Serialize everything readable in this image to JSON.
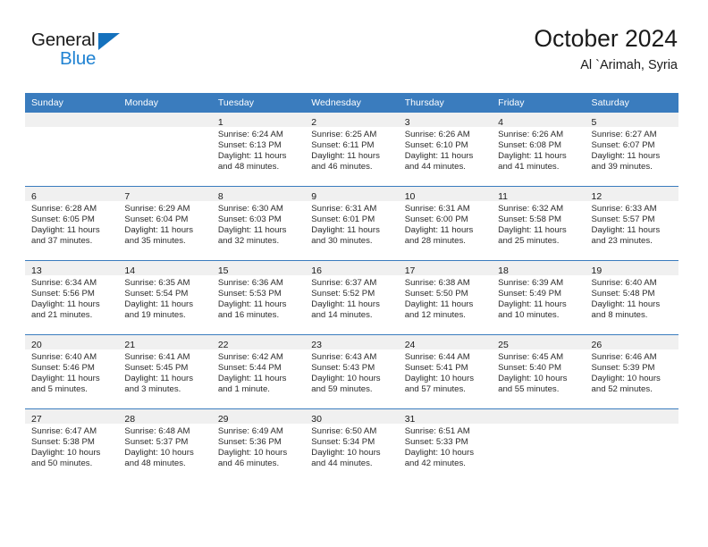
{
  "brand": {
    "name_top": "General",
    "name_bottom": "Blue",
    "triangle_color": "#1471bd",
    "blue_color": "#1f82d2"
  },
  "header": {
    "title": "October 2024",
    "subtitle": "Al `Arimah, Syria"
  },
  "theme": {
    "header_row_bg": "#3a7cbe",
    "daynum_band_bg": "#f0f0f0",
    "row_rule": "#3a7cbe",
    "text": "#1a1a1a"
  },
  "weekday_headers": [
    "Sunday",
    "Monday",
    "Tuesday",
    "Wednesday",
    "Thursday",
    "Friday",
    "Saturday"
  ],
  "weeks": [
    [
      {
        "day": "",
        "lines": []
      },
      {
        "day": "",
        "lines": []
      },
      {
        "day": "1",
        "lines": [
          "Sunrise: 6:24 AM",
          "Sunset: 6:13 PM",
          "Daylight: 11 hours",
          "and 48 minutes."
        ]
      },
      {
        "day": "2",
        "lines": [
          "Sunrise: 6:25 AM",
          "Sunset: 6:11 PM",
          "Daylight: 11 hours",
          "and 46 minutes."
        ]
      },
      {
        "day": "3",
        "lines": [
          "Sunrise: 6:26 AM",
          "Sunset: 6:10 PM",
          "Daylight: 11 hours",
          "and 44 minutes."
        ]
      },
      {
        "day": "4",
        "lines": [
          "Sunrise: 6:26 AM",
          "Sunset: 6:08 PM",
          "Daylight: 11 hours",
          "and 41 minutes."
        ]
      },
      {
        "day": "5",
        "lines": [
          "Sunrise: 6:27 AM",
          "Sunset: 6:07 PM",
          "Daylight: 11 hours",
          "and 39 minutes."
        ]
      }
    ],
    [
      {
        "day": "6",
        "lines": [
          "Sunrise: 6:28 AM",
          "Sunset: 6:05 PM",
          "Daylight: 11 hours",
          "and 37 minutes."
        ]
      },
      {
        "day": "7",
        "lines": [
          "Sunrise: 6:29 AM",
          "Sunset: 6:04 PM",
          "Daylight: 11 hours",
          "and 35 minutes."
        ]
      },
      {
        "day": "8",
        "lines": [
          "Sunrise: 6:30 AM",
          "Sunset: 6:03 PM",
          "Daylight: 11 hours",
          "and 32 minutes."
        ]
      },
      {
        "day": "9",
        "lines": [
          "Sunrise: 6:31 AM",
          "Sunset: 6:01 PM",
          "Daylight: 11 hours",
          "and 30 minutes."
        ]
      },
      {
        "day": "10",
        "lines": [
          "Sunrise: 6:31 AM",
          "Sunset: 6:00 PM",
          "Daylight: 11 hours",
          "and 28 minutes."
        ]
      },
      {
        "day": "11",
        "lines": [
          "Sunrise: 6:32 AM",
          "Sunset: 5:58 PM",
          "Daylight: 11 hours",
          "and 25 minutes."
        ]
      },
      {
        "day": "12",
        "lines": [
          "Sunrise: 6:33 AM",
          "Sunset: 5:57 PM",
          "Daylight: 11 hours",
          "and 23 minutes."
        ]
      }
    ],
    [
      {
        "day": "13",
        "lines": [
          "Sunrise: 6:34 AM",
          "Sunset: 5:56 PM",
          "Daylight: 11 hours",
          "and 21 minutes."
        ]
      },
      {
        "day": "14",
        "lines": [
          "Sunrise: 6:35 AM",
          "Sunset: 5:54 PM",
          "Daylight: 11 hours",
          "and 19 minutes."
        ]
      },
      {
        "day": "15",
        "lines": [
          "Sunrise: 6:36 AM",
          "Sunset: 5:53 PM",
          "Daylight: 11 hours",
          "and 16 minutes."
        ]
      },
      {
        "day": "16",
        "lines": [
          "Sunrise: 6:37 AM",
          "Sunset: 5:52 PM",
          "Daylight: 11 hours",
          "and 14 minutes."
        ]
      },
      {
        "day": "17",
        "lines": [
          "Sunrise: 6:38 AM",
          "Sunset: 5:50 PM",
          "Daylight: 11 hours",
          "and 12 minutes."
        ]
      },
      {
        "day": "18",
        "lines": [
          "Sunrise: 6:39 AM",
          "Sunset: 5:49 PM",
          "Daylight: 11 hours",
          "and 10 minutes."
        ]
      },
      {
        "day": "19",
        "lines": [
          "Sunrise: 6:40 AM",
          "Sunset: 5:48 PM",
          "Daylight: 11 hours",
          "and 8 minutes."
        ]
      }
    ],
    [
      {
        "day": "20",
        "lines": [
          "Sunrise: 6:40 AM",
          "Sunset: 5:46 PM",
          "Daylight: 11 hours",
          "and 5 minutes."
        ]
      },
      {
        "day": "21",
        "lines": [
          "Sunrise: 6:41 AM",
          "Sunset: 5:45 PM",
          "Daylight: 11 hours",
          "and 3 minutes."
        ]
      },
      {
        "day": "22",
        "lines": [
          "Sunrise: 6:42 AM",
          "Sunset: 5:44 PM",
          "Daylight: 11 hours",
          "and 1 minute."
        ]
      },
      {
        "day": "23",
        "lines": [
          "Sunrise: 6:43 AM",
          "Sunset: 5:43 PM",
          "Daylight: 10 hours",
          "and 59 minutes."
        ]
      },
      {
        "day": "24",
        "lines": [
          "Sunrise: 6:44 AM",
          "Sunset: 5:41 PM",
          "Daylight: 10 hours",
          "and 57 minutes."
        ]
      },
      {
        "day": "25",
        "lines": [
          "Sunrise: 6:45 AM",
          "Sunset: 5:40 PM",
          "Daylight: 10 hours",
          "and 55 minutes."
        ]
      },
      {
        "day": "26",
        "lines": [
          "Sunrise: 6:46 AM",
          "Sunset: 5:39 PM",
          "Daylight: 10 hours",
          "and 52 minutes."
        ]
      }
    ],
    [
      {
        "day": "27",
        "lines": [
          "Sunrise: 6:47 AM",
          "Sunset: 5:38 PM",
          "Daylight: 10 hours",
          "and 50 minutes."
        ]
      },
      {
        "day": "28",
        "lines": [
          "Sunrise: 6:48 AM",
          "Sunset: 5:37 PM",
          "Daylight: 10 hours",
          "and 48 minutes."
        ]
      },
      {
        "day": "29",
        "lines": [
          "Sunrise: 6:49 AM",
          "Sunset: 5:36 PM",
          "Daylight: 10 hours",
          "and 46 minutes."
        ]
      },
      {
        "day": "30",
        "lines": [
          "Sunrise: 6:50 AM",
          "Sunset: 5:34 PM",
          "Daylight: 10 hours",
          "and 44 minutes."
        ]
      },
      {
        "day": "31",
        "lines": [
          "Sunrise: 6:51 AM",
          "Sunset: 5:33 PM",
          "Daylight: 10 hours",
          "and 42 minutes."
        ]
      },
      {
        "day": "",
        "lines": []
      },
      {
        "day": "",
        "lines": []
      }
    ]
  ]
}
